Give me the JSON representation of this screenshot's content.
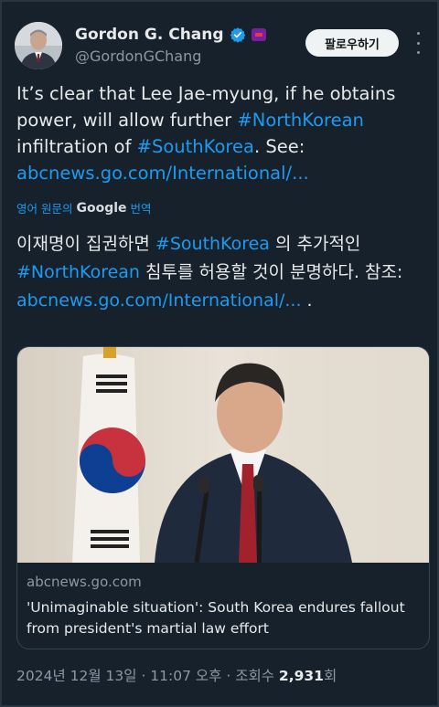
{
  "author": {
    "name": "Gordon G. Chang",
    "handle": "@GordonGChang"
  },
  "follow_button": "팔로우하기",
  "tweet": {
    "text_1": "It’s clear that Lee Jae-myung, if he obtains power, will allow further ",
    "hashtag_1": "#NorthKorean",
    "text_2": " infiltration of ",
    "hashtag_2": "#SouthKorea",
    "text_3": ". See: ",
    "link": "abcnews.go.com/International/..."
  },
  "translation_label": {
    "prefix": "영어 원문의",
    "google": "Google",
    "suffix": "번역"
  },
  "translation": {
    "text_1": "이재명이 집권하면 ",
    "hashtag_1": "#SouthKorea",
    "text_2": " 의 추가적인 ",
    "hashtag_2": "#NorthKorean",
    "text_3": " 침투를 허용할 것이 분명하다. 참조: ",
    "link": "abcnews.go.com/International/...",
    "text_4": " ."
  },
  "link_card": {
    "domain": "abcnews.go.com",
    "title": "'Unimaginable situation': South Korea endures fallout from president's martial law effort"
  },
  "meta": {
    "timestamp": "2024년 12월 13일 · 11:07 오후 · 조회수 ",
    "views": "2,931",
    "views_suffix": "회"
  },
  "colors": {
    "background": "#15202b",
    "link": "#1d9bf0",
    "secondary_text": "#8b98a5",
    "primary_text": "#e7e9ea"
  },
  "icons": [
    "verified-badge-icon",
    "affiliation-badge-icon",
    "more-icon"
  ]
}
